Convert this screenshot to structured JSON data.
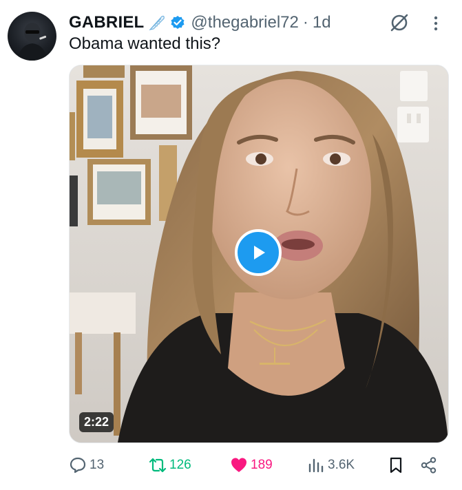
{
  "tweet": {
    "author_name": "GABRIEL",
    "handle": "@thegabriel72",
    "separator": "·",
    "time": "1d",
    "text": "Obama wanted this?"
  },
  "media": {
    "duration": "2:22"
  },
  "actions": {
    "replies": "13",
    "retweets": "126",
    "likes": "189",
    "views": "3.6K"
  },
  "colors": {
    "accent": "#1d9bf0",
    "retweet": "#00ba7c",
    "like": "#f91880",
    "muted": "#536471"
  },
  "icons": [
    "feather-emoji-icon",
    "verified-badge-icon",
    "grok-icon",
    "more-options-icon",
    "play-icon",
    "reply-icon",
    "retweet-icon",
    "like-heart-icon",
    "views-chart-icon",
    "bookmark-icon",
    "share-icon"
  ]
}
